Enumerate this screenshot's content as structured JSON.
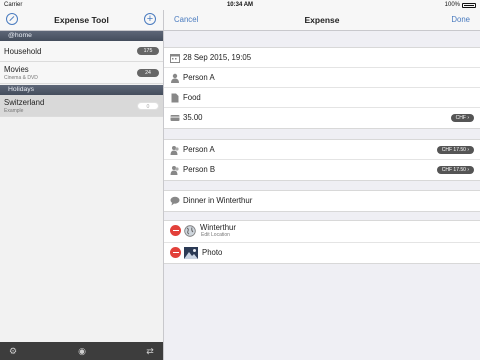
{
  "status": {
    "carrier": "Carrier",
    "time": "10:34 AM",
    "battery": "100%"
  },
  "master": {
    "title": "Expense Tool",
    "sections": [
      {
        "header": "@home",
        "items": [
          {
            "label": "Household",
            "sub": "",
            "count": "175"
          },
          {
            "label": "Movies",
            "sub": "Cinema & DVD",
            "count": "24"
          }
        ]
      },
      {
        "header": "Holidays",
        "items": [
          {
            "label": "Switzerland",
            "sub": "Example",
            "count": "0"
          }
        ]
      }
    ],
    "toolbar": {
      "settings_icon": "gear-icon",
      "eye_icon": "eye-icon",
      "sync_icon": "repeat-icon"
    }
  },
  "detail": {
    "cancel": "Cancel",
    "title": "Expense",
    "done": "Done",
    "info": {
      "date": "28 Sep 2015, 19:05",
      "payer": "Person A",
      "category": "Food",
      "amount": "35.00",
      "currency": "CHF"
    },
    "shares": [
      {
        "person": "Person A",
        "amount": "CHF 17.50"
      },
      {
        "person": "Person B",
        "amount": "CHF 17.50"
      }
    ],
    "note": "Dinner in Winterthur",
    "attachments": {
      "location": "Winterthur",
      "location_sub": "Edit Location",
      "photo": "Photo"
    }
  },
  "colors": {
    "accent": "#4a7bbf",
    "section_header": "#4d5666",
    "delete": "#e2403a",
    "pill": "#555555"
  }
}
